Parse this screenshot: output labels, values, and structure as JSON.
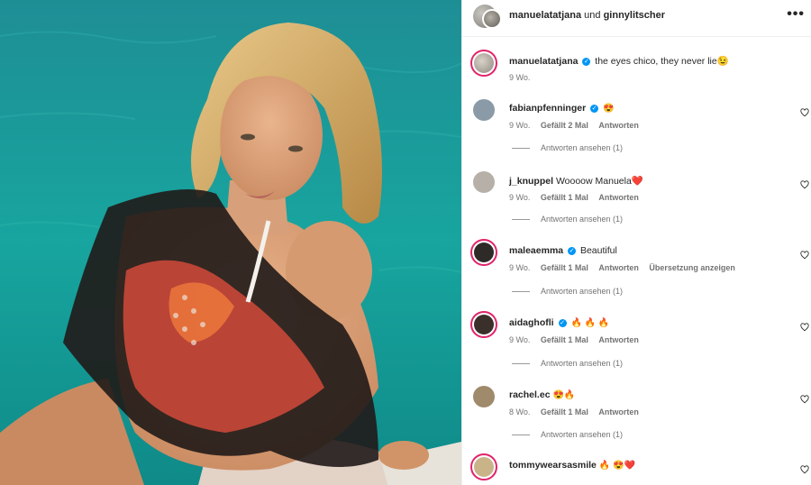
{
  "header": {
    "user1": "manuelatatjana",
    "joiner": "und",
    "user2": "ginnylitscher",
    "more_icon": "more-horizontal-icon"
  },
  "caption": {
    "username": "manuelatatjana",
    "verified": true,
    "text": "the eyes chico, they never lie😉",
    "time": "9 Wo."
  },
  "comments": [
    {
      "username": "fabianpfenninger",
      "verified": true,
      "text": "😍",
      "time": "9 Wo.",
      "likes": "Gefällt 2 Mal",
      "reply": "Antworten",
      "view_replies": "Antworten ansehen (1)",
      "color": "#8a9aa6"
    },
    {
      "username": "j_knuppel",
      "verified": false,
      "text": "Woooow Manuela❤️",
      "time": "9 Wo.",
      "likes": "Gefällt 1 Mal",
      "reply": "Antworten",
      "view_replies": "Antworten ansehen (1)",
      "color": "#b7b0a8"
    },
    {
      "username": "maleaemma",
      "verified": true,
      "text": "Beautiful",
      "time": "9 Wo.",
      "likes": "Gefällt 1 Mal",
      "reply": "Antworten",
      "translate": "Übersetzung anzeigen",
      "view_replies": "Antworten ansehen (1)",
      "color": "#2d2a28"
    },
    {
      "username": "aidaghofli",
      "verified": true,
      "text": "🔥 🔥 🔥",
      "time": "9 Wo.",
      "likes": "Gefällt 1 Mal",
      "reply": "Antworten",
      "view_replies": "Antworten ansehen (1)",
      "color": "#3a2f2a"
    },
    {
      "username": "rachel.ec",
      "verified": false,
      "text": "😍🔥",
      "time": "8 Wo.",
      "likes": "Gefällt 1 Mal",
      "reply": "Antworten",
      "view_replies": "Antworten ansehen (1)",
      "color": "#a08a6c"
    },
    {
      "username": "tommywearsasmile",
      "verified": false,
      "text": "🔥 😍❤️",
      "color": "#c9b48a"
    }
  ]
}
